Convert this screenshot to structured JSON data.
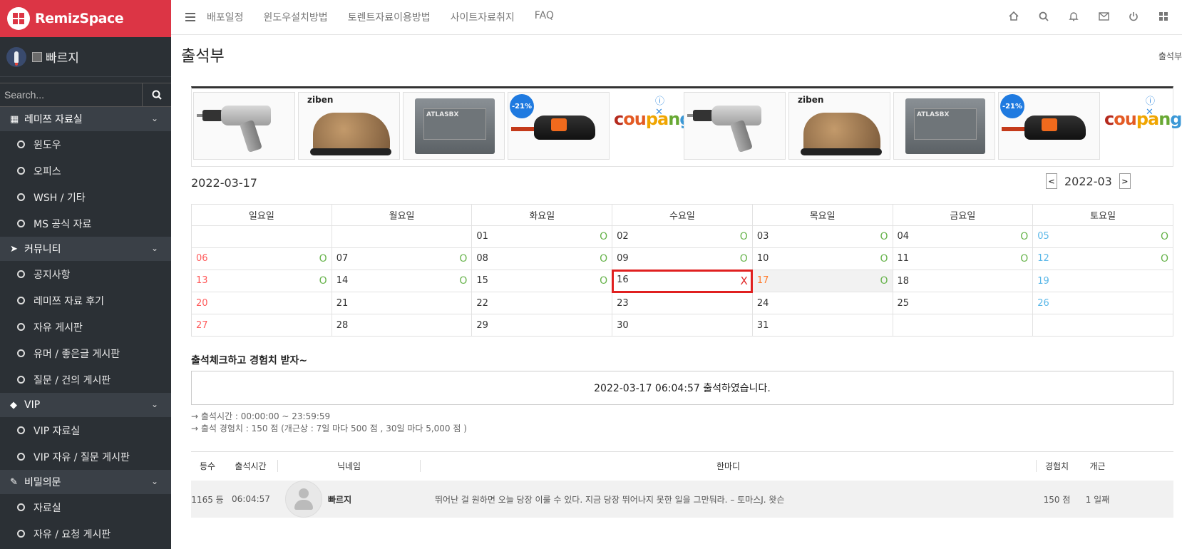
{
  "brand": {
    "name": "RemizSpace"
  },
  "user": {
    "name": "빠르지"
  },
  "search": {
    "placeholder": "Search..."
  },
  "sidebar": {
    "sections": [
      {
        "title": "레미쯔 자료실",
        "items": [
          "윈도우",
          "오피스",
          "WSH / 기타",
          "MS 공식 자료"
        ]
      },
      {
        "title": "커뮤니티",
        "items": [
          "공지사항",
          "레미쯔 자료 후기",
          "자유 게시판",
          "유머 / 좋은글 게시판",
          "질문 / 건의 게시판"
        ]
      },
      {
        "title": "VIP",
        "items": [
          "VIP 자료실",
          "VIP 자유 / 질문 게시판"
        ]
      },
      {
        "title": "비밀의문",
        "items": [
          "자료실",
          "자유 / 요청 게시판"
        ]
      }
    ]
  },
  "topnav": {
    "links": [
      "배포일정",
      "윈도우설치방법",
      "토렌트자료이용방법",
      "사이트자료취지",
      "FAQ"
    ]
  },
  "top_icons": [
    "home-icon",
    "search-icon",
    "bell-icon",
    "mail-icon",
    "power-icon",
    "grid-icon"
  ],
  "page": {
    "title": "출석부",
    "crumb": "출석부"
  },
  "ad": {
    "ziben_label": "ziben",
    "battery_label": "ATLASBX",
    "discount": "-21%",
    "coupang": [
      "c",
      "ou",
      "pa",
      "n",
      "g"
    ],
    "close_label": "ⓘ ✕"
  },
  "calendar": {
    "date": "2022-03-17",
    "month": "2022-03",
    "prev_label": "<",
    "next_label": ">",
    "weekdays": [
      "일요일",
      "월요일",
      "화요일",
      "수요일",
      "목요일",
      "금요일",
      "토요일"
    ],
    "weeks": [
      [
        {
          "d": ""
        },
        {
          "d": ""
        },
        {
          "d": "01",
          "m": "O"
        },
        {
          "d": "02",
          "m": "O"
        },
        {
          "d": "03",
          "m": "O"
        },
        {
          "d": "04",
          "m": "O"
        },
        {
          "d": "05",
          "m": "O"
        }
      ],
      [
        {
          "d": "06",
          "m": "O"
        },
        {
          "d": "07",
          "m": "O"
        },
        {
          "d": "08",
          "m": "O"
        },
        {
          "d": "09",
          "m": "O"
        },
        {
          "d": "10",
          "m": "O"
        },
        {
          "d": "11",
          "m": "O"
        },
        {
          "d": "12",
          "m": "O"
        }
      ],
      [
        {
          "d": "13",
          "m": "O"
        },
        {
          "d": "14",
          "m": "O"
        },
        {
          "d": "15",
          "m": "O"
        },
        {
          "d": "16",
          "m": "X"
        },
        {
          "d": "17",
          "m": "O"
        },
        {
          "d": "18"
        },
        {
          "d": "19"
        }
      ],
      [
        {
          "d": "20"
        },
        {
          "d": "21"
        },
        {
          "d": "22"
        },
        {
          "d": "23"
        },
        {
          "d": "24"
        },
        {
          "d": "25"
        },
        {
          "d": "26"
        }
      ],
      [
        {
          "d": "27"
        },
        {
          "d": "28"
        },
        {
          "d": "29"
        },
        {
          "d": "30"
        },
        {
          "d": "31"
        },
        {
          "d": ""
        },
        {
          "d": ""
        }
      ]
    ]
  },
  "attendance": {
    "title": "출석체크하고 경험치 받자~",
    "message": "2022-03-17 06:04:57 출석하였습니다.",
    "info_time": "→ 출석시간 : 00:00:00 ~ 23:59:59",
    "info_exp": "→ 출석 경험치 : 150 점 (개근상 : 7일 마다 500 점 , 30일 마다 5,000 점 )"
  },
  "ranking": {
    "headers": {
      "rank": "등수",
      "time": "출석시간",
      "nick": "닉네임",
      "comment": "한마디",
      "exp": "경험치",
      "streak": "개근"
    },
    "rows": [
      {
        "rank": "1165 등",
        "time": "06:04:57",
        "nick": "빠르지",
        "comment": "뛰어난 걸 원하면 오늘 당장 이룰 수 있다. 지금 당장 뛰어나지 못한 일을 그만둬라. – 토마스J. 왓슨",
        "exp": "150 점",
        "streak": "1 일째"
      }
    ]
  }
}
